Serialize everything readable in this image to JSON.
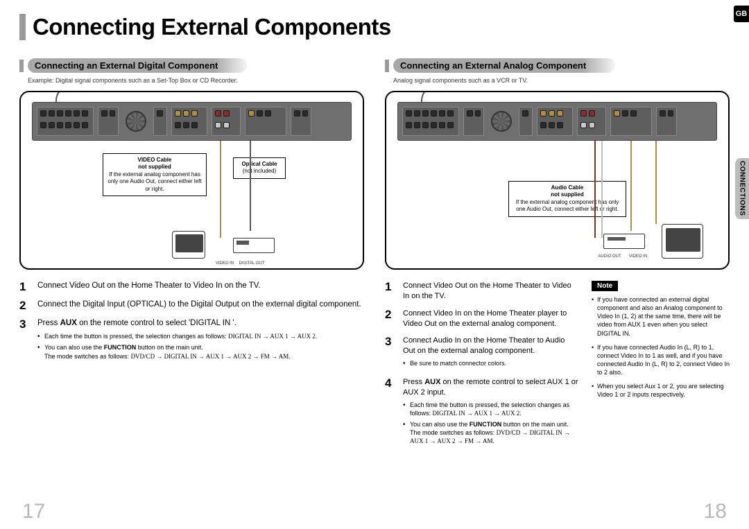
{
  "lang_tab": "GB",
  "side_tab": "CONNECTIONS",
  "page_title": "Connecting External Components",
  "page_left": "17",
  "page_right": "18",
  "left": {
    "heading": "Connecting an External Digital Component",
    "subcaption": "Example: Digital signal components such as a Set-Top Box or CD Recorder.",
    "callout_video_title": "VIDEO Cable",
    "callout_video_sub": "not supplied",
    "callout_video_body": "If the external analog component has only one Audio Out, connect either left or right.",
    "callout_optical_title": "Optical Cable",
    "callout_optical_sub": "(not included)",
    "diagram_label_video_in": "VIDEO IN",
    "diagram_label_digital_out": "DIGITAL OUT",
    "step1": "Connect Video Out on the Home Theater to Video In on the TV.",
    "step2": "Connect the Digital Input (OPTICAL) to the Digital Output on the external digital component.",
    "step3_pre": "Press ",
    "step3_bold1": "AUX",
    "step3_post": " on the remote control to select 'DIGITAL IN '.",
    "bullet1": "Each time the button is pressed, the selection changes as follows: ",
    "bullet1_seq": "DIGITAL IN → AUX 1 → AUX 2.",
    "bullet2_pre": "You can also use the ",
    "bullet2_bold": "FUNCTION",
    "bullet2_post": " button on the main unit.",
    "bullet2_line2_pre": "The mode switches as follows: ",
    "bullet2_line2_seq": "DVD/CD → DIGITAL IN → AUX 1 → AUX 2 → FM → AM."
  },
  "right": {
    "heading": "Connecting an External Analog Component",
    "subcaption": "Analog signal components such as a VCR or TV.",
    "callout_audio_title": "Audio Cable",
    "callout_audio_sub": "not supplied",
    "callout_audio_body": "If the external analog component has only one Audio Out, connect either left or right.",
    "diagram_label_audio_out": "AUDIO OUT",
    "diagram_label_video_in": "VIDEO IN",
    "step1": "Connect Video Out on the Home Theater to Video In on the TV.",
    "step2": "Connect Video In on the Home Theater player to Video Out on the external analog component.",
    "step3": "Connect Audio In on the Home Theater to Audio Out on the external analog component.",
    "step3_bullet": "Be sure to match connector colors.",
    "step4_pre": "Press ",
    "step4_bold": "AUX",
    "step4_post": " on the remote control to select AUX 1 or AUX 2 input.",
    "step4_b1": "Each time the button is pressed, the selection changes as follows: ",
    "step4_b1_seq": "DIGITAL IN → AUX 1 → AUX 2.",
    "step4_b2_pre": "You can also use the ",
    "step4_b2_bold": "FUNCTION",
    "step4_b2_post": " button on the main unit. The mode switches as follows: ",
    "step4_b2_seq": "DVD/CD → DIGITAL IN → AUX 1 → AUX 2 → FM → AM.",
    "note_label": "Note",
    "note1": "If you have connected an external digital component and also an Analog component to Video In (1, 2) at the same time, there will be video from AUX 1 even when you select DIGITAL IN.",
    "note2": "If you have connected Audio In (L, R) to 1, connect Video In to 1 as well, and if you have connected Audio In (L, R) to 2, connect Video In to 2 also.",
    "note3": "When you select Aux 1 or 2, you are selecting Video 1 or 2 inputs respectively."
  }
}
